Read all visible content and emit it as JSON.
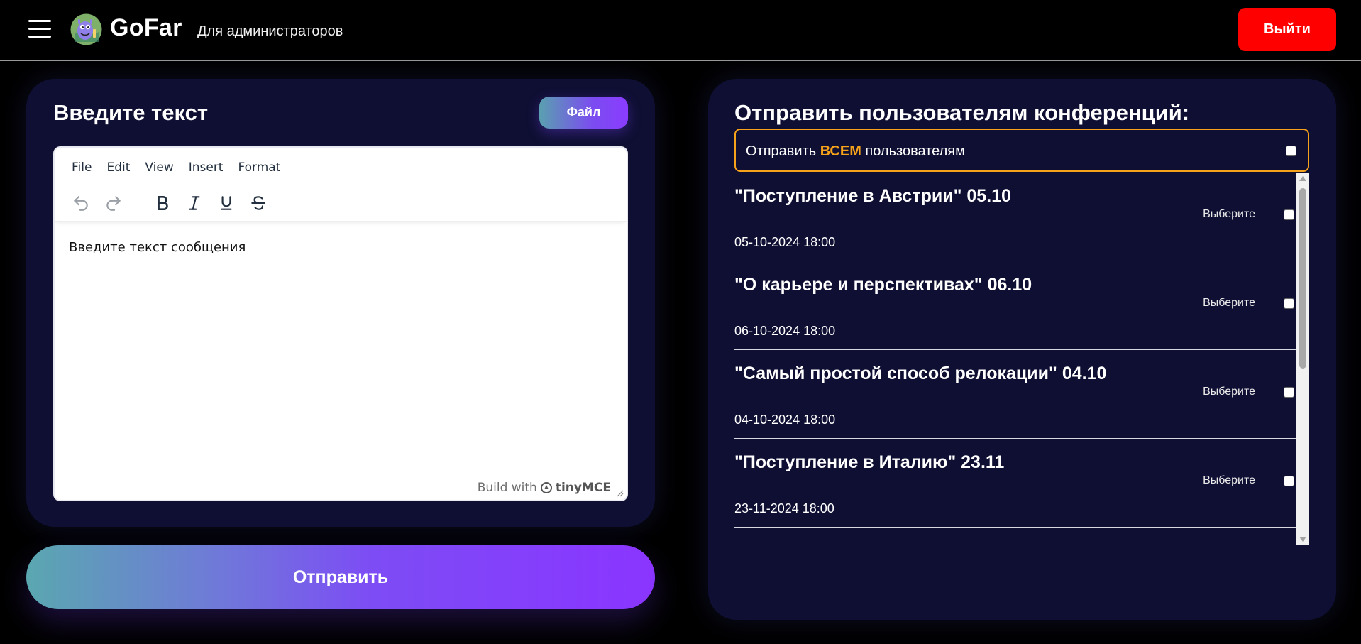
{
  "header": {
    "brand": "GoFar",
    "subtitle": "Для администраторов",
    "logout_label": "Выйти"
  },
  "editor_card": {
    "title": "Введите текст",
    "file_button": "Файл",
    "menu": [
      "File",
      "Edit",
      "View",
      "Insert",
      "Format"
    ],
    "toolbar_icons": [
      "undo-icon",
      "redo-icon",
      "bold-icon",
      "italic-icon",
      "underline-icon",
      "strikethrough-icon"
    ],
    "placeholder": "Введите текст сообщения",
    "build_with": "Build with",
    "tiny_brand": "tinyMCE"
  },
  "send_button": "Отправить",
  "conferences": {
    "title": "Отправить пользователям конференций:",
    "send_all": {
      "prefix": "Отправить",
      "highlight": "ВСЕМ",
      "suffix": "пользователям",
      "checked": false
    },
    "items": [
      {
        "title": "\"Поступление в Австрии\" 05.10",
        "pick_label": "Выберите",
        "date": "05-10-2024 18:00",
        "checked": false
      },
      {
        "title": "\"О карьере и перспективах\" 06.10",
        "pick_label": "Выберите",
        "date": "06-10-2024 18:00",
        "checked": false
      },
      {
        "title": "\"Самый простой способ релокации\" 04.10",
        "pick_label": "Выберите",
        "date": "04-10-2024 18:00",
        "checked": false
      },
      {
        "title": "\"Поступление в Италию\" 23.11",
        "pick_label": "Выберите",
        "date": "23-11-2024 18:00",
        "checked": false
      }
    ]
  },
  "colors": {
    "background": "#000000",
    "card": "#0f0f33",
    "logout": "#ff0000",
    "highlight": "#f6a21a",
    "gradient_start": "#5aa7b0",
    "gradient_end": "#8a35ff"
  }
}
